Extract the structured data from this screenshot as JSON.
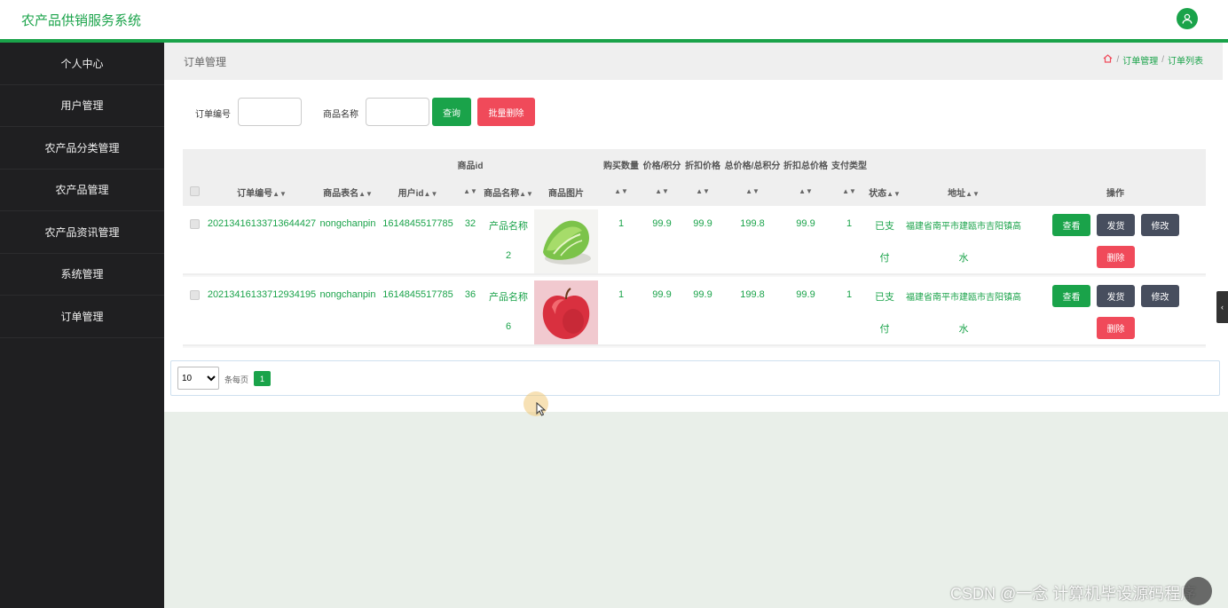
{
  "app": {
    "title": "农产品供销服务系统"
  },
  "sidebar": {
    "items": [
      {
        "label": "个人中心"
      },
      {
        "label": "用户管理"
      },
      {
        "label": "农产品分类管理"
      },
      {
        "label": "农产品管理"
      },
      {
        "label": "农产品资讯管理"
      },
      {
        "label": "系统管理"
      },
      {
        "label": "订单管理"
      }
    ]
  },
  "page": {
    "title": "订单管理"
  },
  "breadcrumb": {
    "items": [
      "订单管理",
      "订单列表"
    ],
    "separator": "/"
  },
  "search": {
    "order_no_label": "订单编号",
    "order_no_value": "",
    "product_name_label": "商品名称",
    "product_name_value": "",
    "query_button": "查询",
    "batch_delete_button": "批量删除"
  },
  "table": {
    "top_headers": {
      "product_id": "商品id",
      "quantity": "购买数量",
      "price": "价格/积分",
      "discount_price": "折扣价格",
      "total": "总价格/总积分",
      "discount_total": "折扣总价格",
      "pay_type": "支付类型"
    },
    "headers": {
      "order_no": "订单编号",
      "table_name": "商品表名",
      "user_id": "用户id",
      "product_name": "商品名称",
      "image": "商品图片",
      "status": "状态",
      "address": "地址",
      "actions": "操作"
    },
    "rows": [
      {
        "order_no": "20213416133713644427",
        "table_name": "nongchanpin",
        "user_id": "1614845517785",
        "product_id": "32",
        "product_name_1": "产品名称",
        "product_name_2": "2",
        "image": "lettuce",
        "quantity": "1",
        "price": "99.9",
        "discount_price": "99.9",
        "total": "199.8",
        "discount_total": "99.9",
        "pay_type": "1",
        "status_1": "已支",
        "status_2": "付",
        "address_1": "福建省南平市建瓯市吉阳镇高",
        "address_2": "水"
      },
      {
        "order_no": "20213416133712934195",
        "table_name": "nongchanpin",
        "user_id": "1614845517785",
        "product_id": "36",
        "product_name_1": "产品名称",
        "product_name_2": "6",
        "image": "apple",
        "quantity": "1",
        "price": "99.9",
        "discount_price": "99.9",
        "total": "199.8",
        "discount_total": "99.9",
        "pay_type": "1",
        "status_1": "已支",
        "status_2": "付",
        "address_1": "福建省南平市建瓯市吉阳镇高",
        "address_2": "水"
      }
    ],
    "actions": {
      "view": "查看",
      "ship": "发货",
      "edit": "修改",
      "delete": "删除"
    }
  },
  "pagination": {
    "page_size": "10",
    "per_page_label": "条每页",
    "current_page": "1"
  },
  "watermark": "CSDN @一念 计算机毕设源码程序",
  "colors": {
    "accent": "#1aa34a",
    "danger": "#f04a5a",
    "dark_button": "#474e5e",
    "sidebar_bg": "#1f1f21"
  }
}
